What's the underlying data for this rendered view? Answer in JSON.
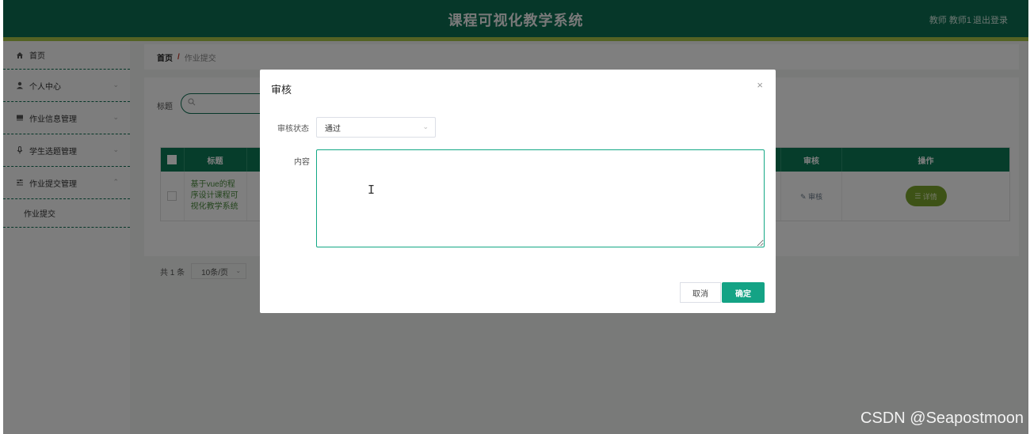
{
  "header": {
    "title": "课程可视化教学系统",
    "user": "教师 教师1",
    "logout": "退出登录"
  },
  "sidebar": {
    "items": [
      {
        "label": "首页",
        "icon": "home-icon"
      },
      {
        "label": "个人中心",
        "icon": "user-icon"
      },
      {
        "label": "作业信息管理",
        "icon": "book-icon"
      },
      {
        "label": "学生选题管理",
        "icon": "mic-icon"
      },
      {
        "label": "作业提交管理",
        "icon": "sliders-icon"
      }
    ],
    "sub_item": "作业提交"
  },
  "breadcrumb": {
    "home": "首页",
    "sep": "/",
    "current": "作业提交"
  },
  "search": {
    "label": "标题"
  },
  "table": {
    "headers": {
      "title": "标题",
      "audit": "审核",
      "action": "操作"
    },
    "rows": [
      {
        "title": "基于vue的程序设计课程可视化教学系统",
        "audit": "审核",
        "detail": "详情"
      }
    ]
  },
  "pager": {
    "total": "共 1 条",
    "page_size": "10条/页"
  },
  "modal": {
    "title": "审核",
    "status_label": "审核状态",
    "status_value": "通过",
    "content_label": "内容",
    "content_value": "",
    "cancel": "取消",
    "confirm": "确定"
  },
  "watermark": "CSDN @Seapostmoon",
  "colors": {
    "brand": "#0d6f52",
    "accent": "#a8c447",
    "primary_button": "#14a385"
  }
}
